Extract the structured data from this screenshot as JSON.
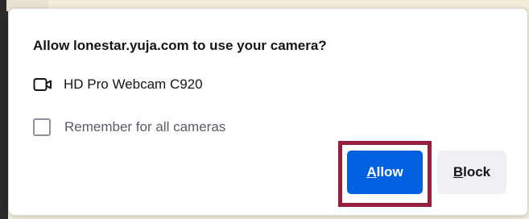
{
  "dialog": {
    "title": "Allow lonestar.yuja.com to use your camera?",
    "device": {
      "icon": "camera-icon",
      "name": "HD Pro Webcam C920"
    },
    "remember": {
      "label": "Remember for all cameras",
      "checked": false
    },
    "buttons": {
      "allow": {
        "accesskey": "A",
        "rest": "llow",
        "color": "#0261e0"
      },
      "block": {
        "accesskey": "B",
        "rest": "lock"
      }
    },
    "highlight_color": "#9a1f3d"
  }
}
